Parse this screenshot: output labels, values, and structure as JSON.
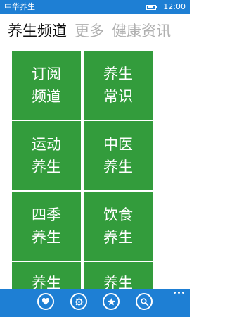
{
  "status_bar": {
    "app_name": "中华养生",
    "time": "12:00"
  },
  "pivot": {
    "tabs": [
      {
        "label": "养生频道",
        "active": true
      },
      {
        "label": "更多",
        "active": false
      },
      {
        "label": "健康资讯",
        "active": false
      }
    ]
  },
  "tiles": [
    {
      "label": "订阅频道"
    },
    {
      "label": "养生常识"
    },
    {
      "label": "运动养生"
    },
    {
      "label": "中医养生"
    },
    {
      "label": "四季养生"
    },
    {
      "label": "饮食养生"
    },
    {
      "label": "养生"
    },
    {
      "label": "养生"
    }
  ],
  "app_bar": {
    "buttons": [
      {
        "icon": "heart-icon"
      },
      {
        "icon": "gear-icon"
      },
      {
        "icon": "star-icon"
      },
      {
        "icon": "search-icon"
      }
    ],
    "more_icon": "more-dots-icon"
  },
  "colors": {
    "accent": "#1e7fd4",
    "tile": "#339c3c",
    "active_tab": "#111111",
    "inactive_tab": "#b0b0b0"
  }
}
